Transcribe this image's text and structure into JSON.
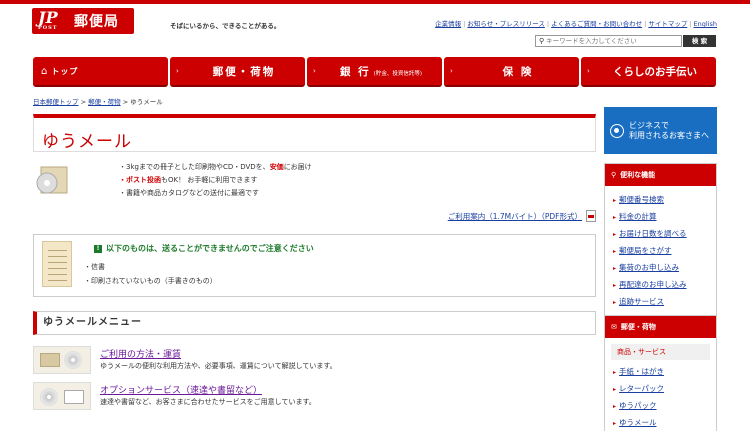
{
  "header": {
    "logo_mark": "JP",
    "logo_post": "POST",
    "logo_text": "郵便局",
    "tagline": "そばにいるから、できることがある。",
    "links": [
      "企業情報",
      "お知らせ・プレスリリース",
      "よくあるご質問・お問い合わせ",
      "サイトマップ",
      "English"
    ],
    "search_placeholder": "キーワードを入力してください",
    "search_button": "検 索"
  },
  "gnav": {
    "top": "トップ",
    "mail": "郵便・荷物",
    "bank": "銀 行",
    "bank_sub": "(貯金、投資信託等)",
    "insurance": "保 険",
    "life": "くらしのお手伝い"
  },
  "breadcrumb": {
    "home": "日本郵便トップ",
    "mail": "郵便・荷物",
    "current": "ゆうメール",
    "sep": ">"
  },
  "page": {
    "title": "ゆうメール",
    "bullet1_pre": "・3kgまでの冊子とした印刷物やCD・DVDを、",
    "bullet1_red": "安価",
    "bullet1_post": "にお届け",
    "bullet2_red": "・ポスト投函",
    "bullet2_post": "もOK！ お手軽に利用できます",
    "bullet3": "・書籍や商品カタログなどの送付に最適です",
    "pdf_link": "ご利用案内（1.7Mバイト）（PDF形式）"
  },
  "warning": {
    "title": "以下のものは、送ることができませんのでご注意ください",
    "items": [
      "・信書",
      "・印刷されていないもの（手書きのもの）"
    ]
  },
  "menu": {
    "title": "ゆうメールメニュー",
    "items": [
      {
        "label": "ご利用の方法・運賃",
        "desc": "ゆうメールの便利な利用方法や、必要事項、運賃について解説しています。"
      },
      {
        "label": "オプションサービス（速達や書留など）",
        "desc": "速達や書留など、お客さまに合わせたサービスをご用意しています。"
      }
    ]
  },
  "sidebar": {
    "biz_line1": "ビジネスで",
    "biz_line2": "利用されるお客さまへ",
    "tools_title": "便利な機能",
    "tools": [
      "郵便番号検索",
      "料金の計算",
      "お届け日数を調べる",
      "郵便局をさがす",
      "集荷のお申し込み",
      "再配達のお申し込み",
      "追跡サービス"
    ],
    "mail_title": "郵便・荷物",
    "mail_sub": "商品・サービス",
    "mail_items": [
      "手紙・はがき",
      "レターパック",
      "ゆうパック",
      "ゆうメール"
    ]
  },
  "colors": {
    "brand": "#cc0000",
    "link": "#1a3fa0",
    "biz": "#1a6ec2",
    "warn": "#1b7a2a"
  }
}
